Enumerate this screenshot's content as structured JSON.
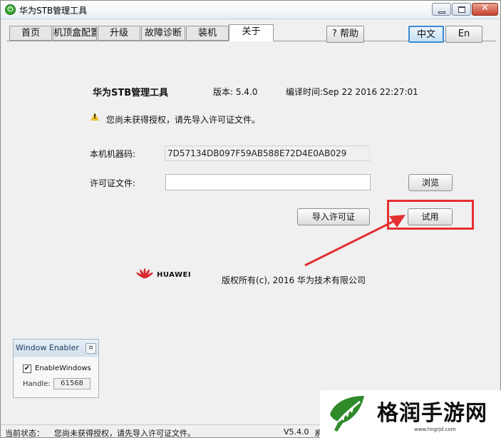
{
  "window": {
    "title": "华为STB管理工具",
    "app_icon_glyph": "⏻",
    "close_glyph": "✕"
  },
  "tabs": [
    {
      "label": "首页",
      "active": false
    },
    {
      "label": "机顶盒配置",
      "active": false
    },
    {
      "label": "升级",
      "active": false
    },
    {
      "label": "故障诊断",
      "active": false
    },
    {
      "label": "装机",
      "active": false
    },
    {
      "label": "关于",
      "active": true
    }
  ],
  "toolbar": {
    "help_label": "? 帮助",
    "lang_zh_label": "中文",
    "lang_en_label": "En",
    "selected_language": "中文"
  },
  "about": {
    "product_name": "华为STB管理工具",
    "version_text": "版本: 5.4.0",
    "build_time_text": "编译时间:Sep 22 2016 22:27:01",
    "warning_text": "您尚未获得授权，请先导入许可证文件。",
    "warning_icon": "warning-triangle-icon",
    "machine_code_label": "本机机器码:",
    "machine_code_value": "7D57134DB097F59AB588E72D4E0AB029",
    "license_file_label": "许可证文件:",
    "license_file_value": "",
    "browse_label": "浏览",
    "import_license_label": "导入许可证",
    "trial_label": "试用",
    "vendor_name": "HUAWEI",
    "copyright_text": "版权所有(c), 2016 华为技术有限公司"
  },
  "annotation": {
    "highlight_color": "#e53030"
  },
  "window_enabler": {
    "title": "Window Enabler",
    "close_glyph": "¤",
    "checkbox_label": "EnableWindows",
    "checkbox_checked": true,
    "checkbox_mark": "✔",
    "handle_label": "Handle:",
    "handle_value": "61568"
  },
  "status_bar": {
    "label": "当前状态：",
    "text": "您尚未获得授权，请先导入许可证文件。",
    "version": "V5.4.0",
    "system_partial": "系"
  },
  "watermark": {
    "name": "格润手游网",
    "url": "www.hngrjd.com",
    "brand_color": "#2f8a2a"
  },
  "colors": {
    "accent_blue": "#3c8ad6",
    "warning_yellow": "#e8c12a",
    "huawei_red": "#d7282f"
  }
}
